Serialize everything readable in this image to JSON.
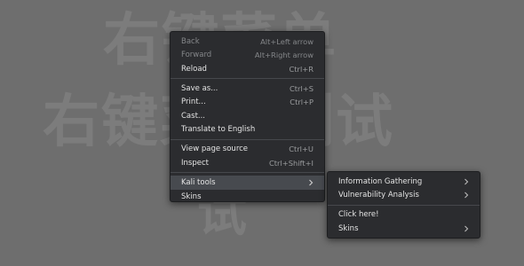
{
  "background": {
    "line1": "右键菜单",
    "line2": "右键菜单测试",
    "line3": "试"
  },
  "main_menu": {
    "items": [
      {
        "label": "Back",
        "shortcut": "Alt+Left arrow"
      },
      {
        "label": "Forward",
        "shortcut": "Alt+Right arrow"
      },
      {
        "label": "Reload",
        "shortcut": "Ctrl+R"
      },
      {
        "label": "Save as...",
        "shortcut": "Ctrl+S"
      },
      {
        "label": "Print...",
        "shortcut": "Ctrl+P"
      },
      {
        "label": "Cast..."
      },
      {
        "label": "Translate to English"
      },
      {
        "label": "View page source",
        "shortcut": "Ctrl+U"
      },
      {
        "label": "Inspect",
        "shortcut": "Ctrl+Shift+I"
      },
      {
        "label": "Kali tools"
      },
      {
        "label": "Skins"
      }
    ]
  },
  "sub_menu": {
    "items": [
      {
        "label": "Information Gathering"
      },
      {
        "label": "Vulnerability Analysis"
      },
      {
        "label": "Click here!"
      },
      {
        "label": "Skins"
      }
    ]
  },
  "colors": {
    "page_bg": "#6e6e6e",
    "menu_bg": "#2b2c2f",
    "highlight": "#474a4f",
    "disabled_text": "#85878a"
  },
  "icons": {
    "submenu_arrow": "chevron-right-icon"
  }
}
